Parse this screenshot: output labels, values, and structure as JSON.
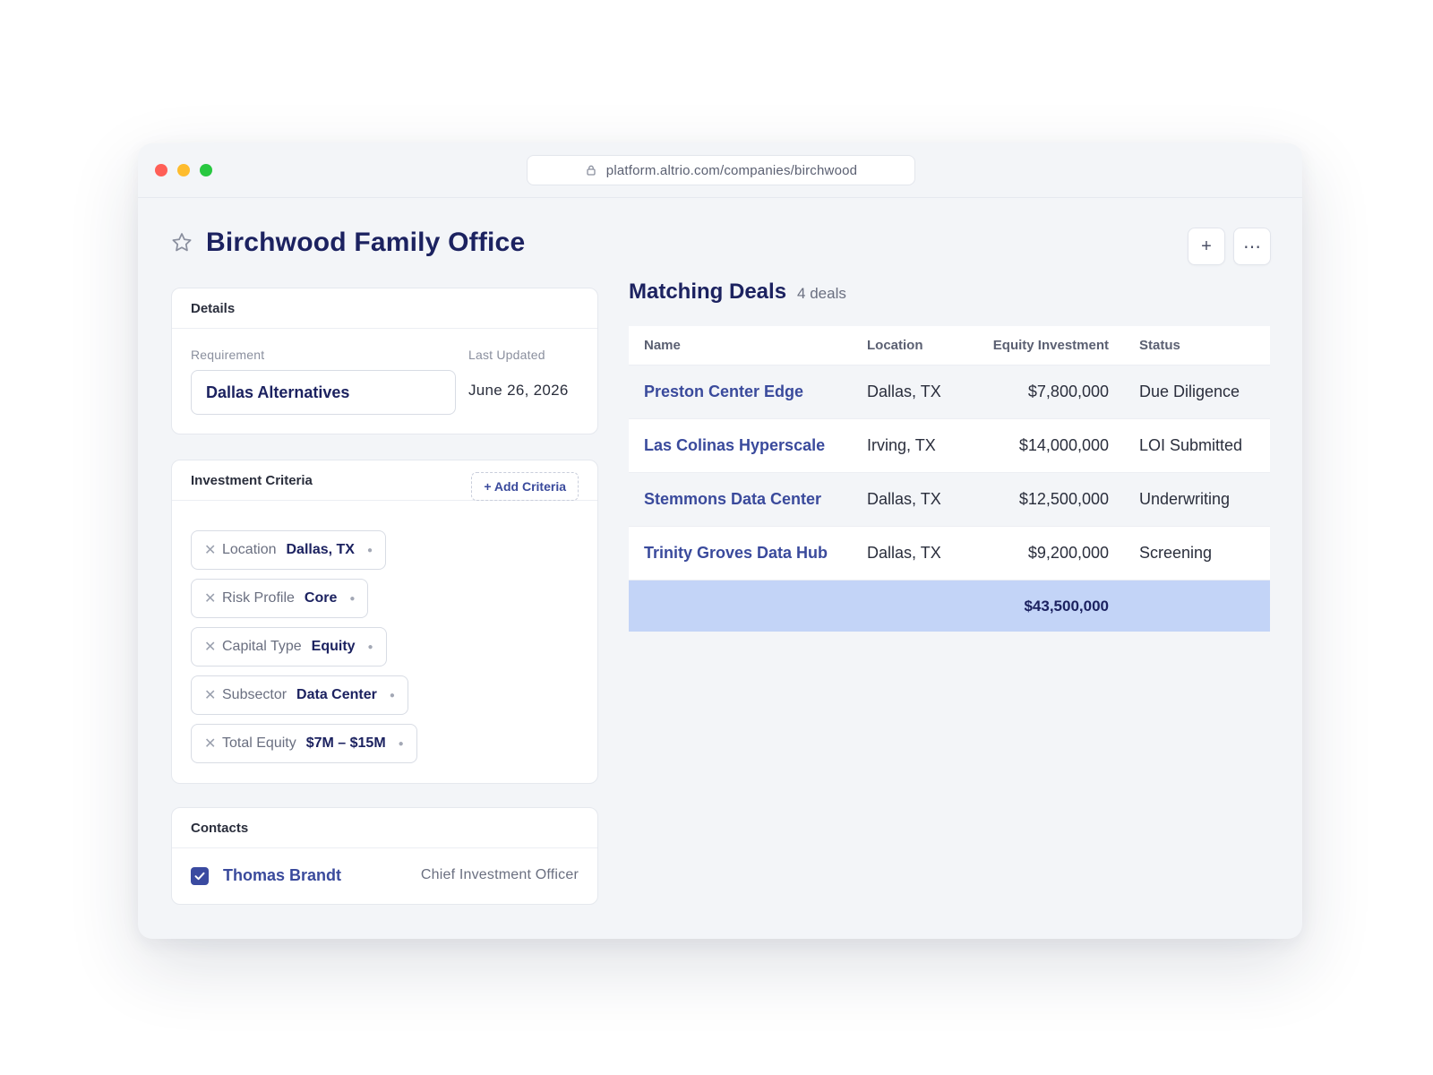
{
  "browser": {
    "url": "platform.altrio.com/companies/birchwood"
  },
  "header": {
    "title": "Birchwood Family Office",
    "add_label": "+",
    "more_label": "⋯"
  },
  "details": {
    "heading": "Details",
    "requirement_label": "Requirement",
    "requirement_value": "Dallas Alternatives",
    "last_updated_label": "Last Updated",
    "last_updated_value": "June 26, 2026"
  },
  "criteria": {
    "heading": "Investment Criteria",
    "add_label": "+ Add Criteria",
    "items": [
      {
        "key": "Location",
        "value": "Dallas, TX"
      },
      {
        "key": "Risk Profile",
        "value": "Core"
      },
      {
        "key": "Capital Type",
        "value": "Equity"
      },
      {
        "key": "Subsector",
        "value": "Data Center"
      },
      {
        "key": "Total Equity",
        "value": "$7M – $15M"
      }
    ]
  },
  "contacts": {
    "heading": "Contacts",
    "items": [
      {
        "name": "Thomas Brandt",
        "role": "Chief Investment Officer",
        "checked": true
      }
    ]
  },
  "deals": {
    "title": "Matching Deals",
    "count": "4 deals",
    "columns": [
      "Name",
      "Location",
      "Equity Investment",
      "Status"
    ],
    "rows": [
      {
        "name": "Preston Center Edge",
        "location": "Dallas, TX",
        "equity": "$7,800,000",
        "status": "Due Diligence"
      },
      {
        "name": "Las Colinas Hyperscale",
        "location": "Irving, TX",
        "equity": "$14,000,000",
        "status": "LOI Submitted"
      },
      {
        "name": "Stemmons Data Center",
        "location": "Dallas, TX",
        "equity": "$12,500,000",
        "status": "Underwriting"
      },
      {
        "name": "Trinity Groves Data Hub",
        "location": "Dallas, TX",
        "equity": "$9,200,000",
        "status": "Screening"
      }
    ],
    "total": "$43,500,000"
  },
  "colors": {
    "brand_navy": "#1c2260",
    "link_blue": "#3a4a9c",
    "total_row": "#c3d4f7"
  }
}
